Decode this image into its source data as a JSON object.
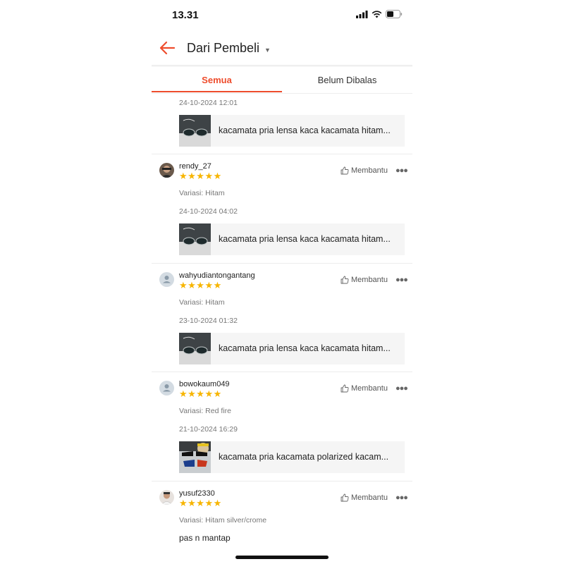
{
  "status_bar": {
    "time": "13.31"
  },
  "header": {
    "title": "Dari Pembeli"
  },
  "tabs": [
    {
      "label": "Semua"
    },
    {
      "label": "Belum Dibalas"
    }
  ],
  "helpful_label": "Membantu",
  "reviews": [
    {
      "datetime": "24-10-2024 12:01",
      "product": "kacamata pria lensa kaca kacamata hitam..."
    },
    {
      "username": "rendy_27",
      "stars": "★★★★★",
      "variation": "Variasi: Hitam",
      "datetime": "24-10-2024 04:02",
      "product": "kacamata pria lensa kaca kacamata hitam..."
    },
    {
      "username": "wahyudiantongantang",
      "stars": "★★★★★",
      "variation": "Variasi: Hitam",
      "datetime": "23-10-2024 01:32",
      "product": "kacamata pria lensa kaca kacamata hitam..."
    },
    {
      "username": "bowokaum049",
      "stars": "★★★★★",
      "variation": "Variasi: Red fire",
      "datetime": "21-10-2024 16:29",
      "product": "kacamata pria kacamata polarized kacam..."
    },
    {
      "username": "yusuf2330",
      "stars": "★★★★★",
      "variation": "Variasi: Hitam silver/crome",
      "comment": "pas n mantap"
    }
  ],
  "colors": {
    "accent": "#ee4d2d",
    "star": "#f7b500"
  }
}
